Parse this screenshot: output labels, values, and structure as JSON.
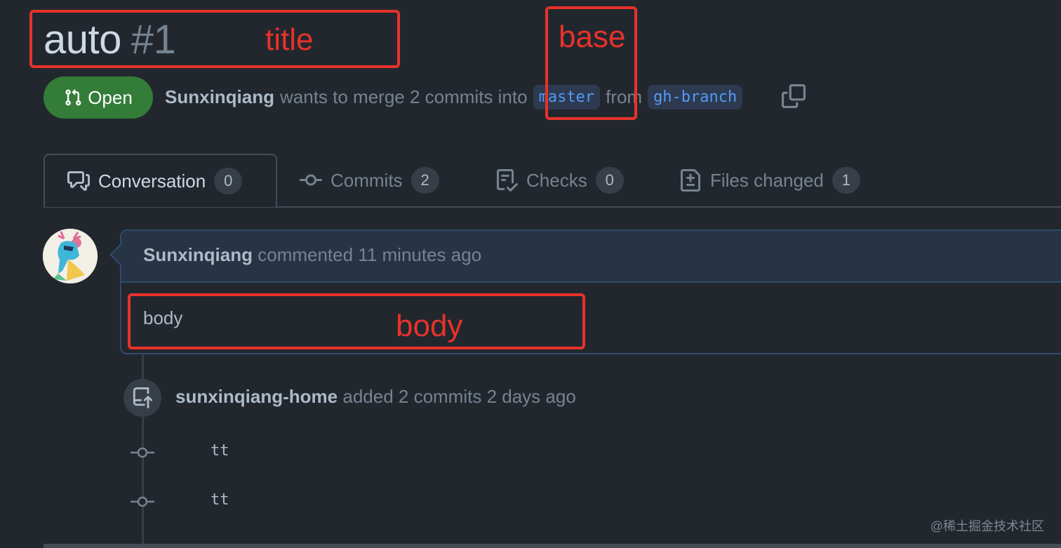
{
  "pr": {
    "title": "auto",
    "number": "#1",
    "state": "Open",
    "author": "Sunxinqiang",
    "merge_text": "wants to merge 2 commits into",
    "base_branch": "master",
    "from_text": "from",
    "head_branch": "gh-branch"
  },
  "tabs": [
    {
      "label": "Conversation",
      "count": "0",
      "icon": "comment-discussion-icon"
    },
    {
      "label": "Commits",
      "count": "2",
      "icon": "commit-icon"
    },
    {
      "label": "Checks",
      "count": "0",
      "icon": "checklist-icon"
    },
    {
      "label": "Files changed",
      "count": "1",
      "icon": "file-diff-icon"
    }
  ],
  "comment": {
    "author": "Sunxinqiang",
    "meta": "commented 11 minutes ago",
    "body": "body"
  },
  "timeline": {
    "push_author": "sunxinqiang-home",
    "push_text": "added 2 commits 2 days ago",
    "commits": [
      "tt",
      "tt"
    ]
  },
  "annotations": {
    "title": "title",
    "base": "base",
    "body": "body",
    "color": "#e8322a"
  },
  "watermark": "@稀土掘金技术社区",
  "colors": {
    "background": "#22272e",
    "open_badge": "#347d39",
    "branch_text": "#539bf5"
  }
}
